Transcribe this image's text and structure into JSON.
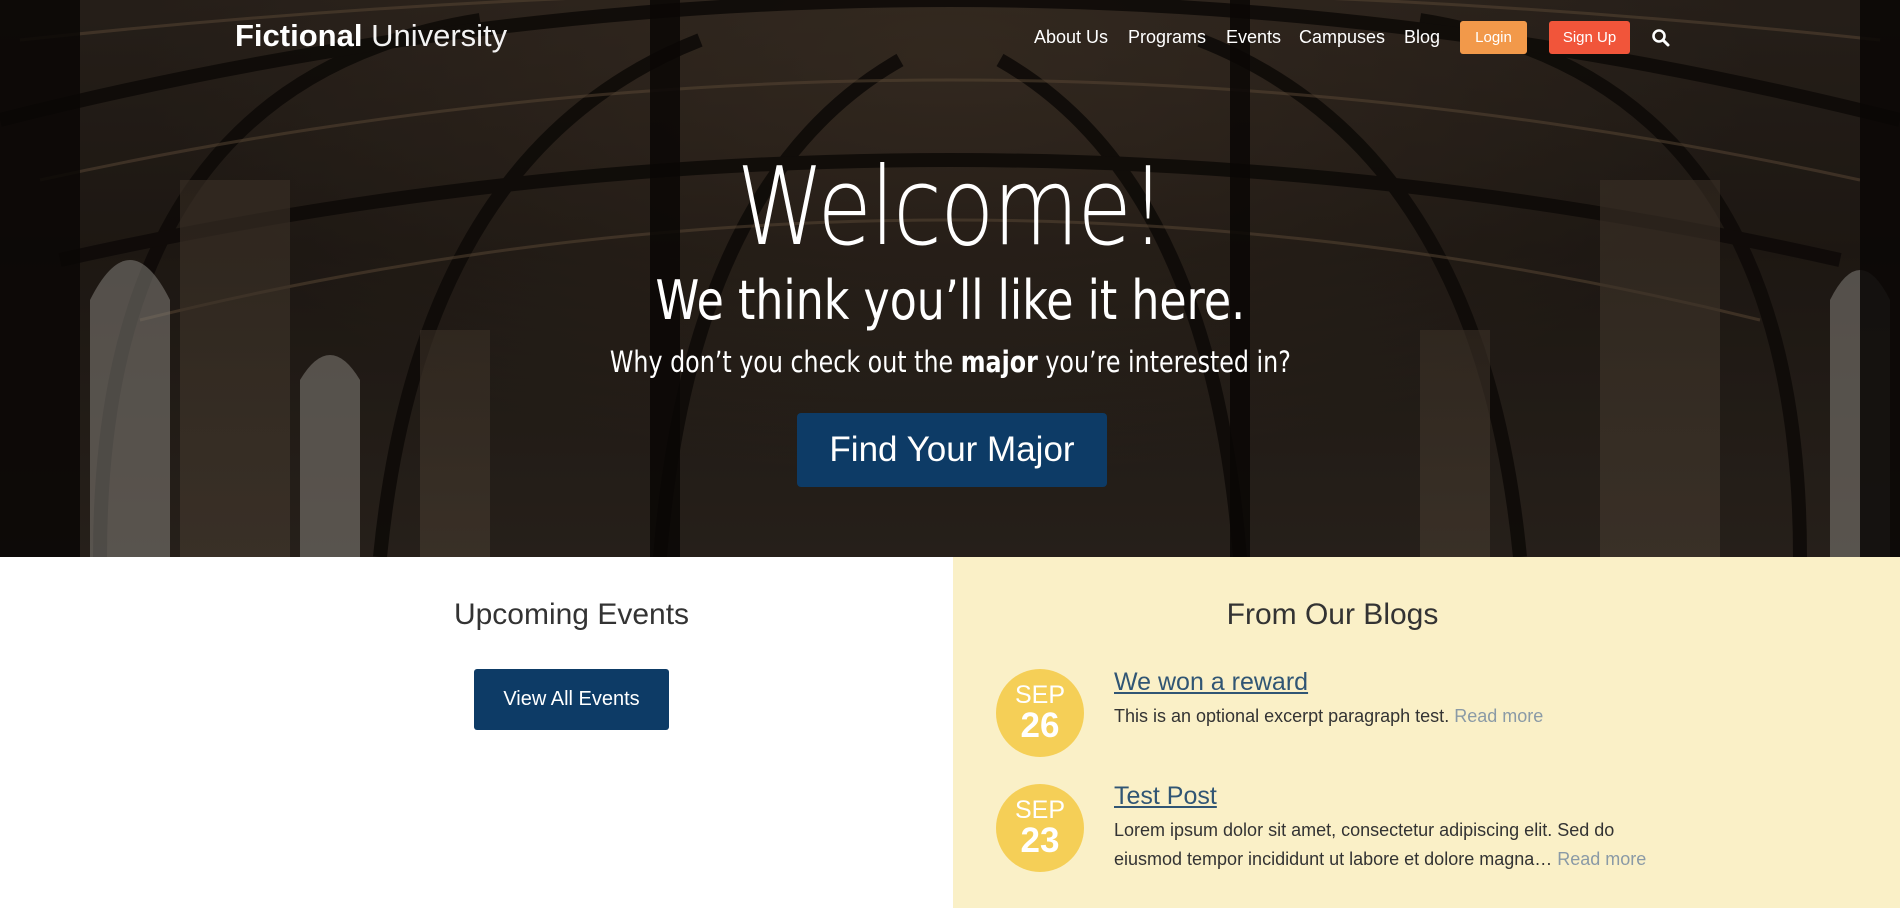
{
  "header": {
    "logo_bold": "Fictional",
    "logo_light": "University",
    "nav": [
      "About Us",
      "Programs",
      "Events",
      "Campuses",
      "Blog"
    ],
    "login_label": "Login",
    "signup_label": "Sign Up",
    "search_icon": "search-icon"
  },
  "hero": {
    "title": "Welcome!",
    "subtitle": "We think you’ll like it here.",
    "tagline_before": "Why don’t you check out the ",
    "tagline_bold": "major",
    "tagline_after": " you’re interested in?",
    "button_label": "Find Your Major"
  },
  "events": {
    "title": "Upcoming Events",
    "button_label": "View All Events"
  },
  "blogs": {
    "title": "From Our Blogs",
    "posts": [
      {
        "month": "SEP",
        "day": "26",
        "title": "We won a reward",
        "excerpt": "This is an optional excerpt paragraph test.",
        "read_more": "Read more"
      },
      {
        "month": "SEP",
        "day": "23",
        "title": "Test Post",
        "excerpt": "Lorem ipsum dolor sit amet, consectetur adipiscing elit. Sed do eiusmod tempor incididunt ut labore et dolore magna…",
        "read_more": "Read more"
      }
    ]
  },
  "colors": {
    "primary_blue": "#0d3b66",
    "login_orange": "#f2994a",
    "signup_red": "#f1553a",
    "date_yellow": "#f5cf57",
    "blog_bg": "#faf0c7"
  }
}
